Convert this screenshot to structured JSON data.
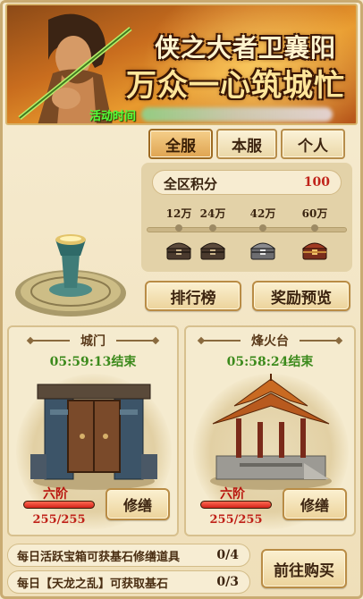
{
  "banner": {
    "title_line1": "侠之大者卫襄阳",
    "title_line2": "万众一心筑城忙",
    "time_label": "活动时间"
  },
  "tabs": [
    {
      "label": "全服",
      "active": true
    },
    {
      "label": "本服",
      "active": false
    },
    {
      "label": "个人",
      "active": false
    }
  ],
  "score": {
    "label": "全区积分",
    "value": "100",
    "progress_fraction": 0.0,
    "milestones": [
      "12万",
      "24万",
      "42万",
      "60万"
    ],
    "chest_icons": [
      "chest-bronze-icon",
      "chest-bronze-icon",
      "chest-silver-icon",
      "chest-gold-icon"
    ]
  },
  "buttons": {
    "ranking": "排行榜",
    "reward_preview": "奖励预览",
    "go_buy": "前往购买"
  },
  "buildings": [
    {
      "name": "城门",
      "timer": "05:59:13结束",
      "level": "六阶",
      "hp": "255/255",
      "hp_fraction": 1.0,
      "repair": "修缮"
    },
    {
      "name": "烽火台",
      "timer": "05:58:24结束",
      "level": "六阶",
      "hp": "255/255",
      "hp_fraction": 1.0,
      "repair": "修缮"
    }
  ],
  "tasks": [
    {
      "text": "每日活跃宝箱可获基石修缮道具",
      "count": "0/4"
    },
    {
      "text": "每日【天龙之乱】可获取基石",
      "count": "0/3"
    }
  ],
  "colors": {
    "accent_orange": "#e07a2a",
    "score_red": "#c0231a",
    "timer_green": "#3c8a1c",
    "time_label_green": "#54ff3a"
  }
}
